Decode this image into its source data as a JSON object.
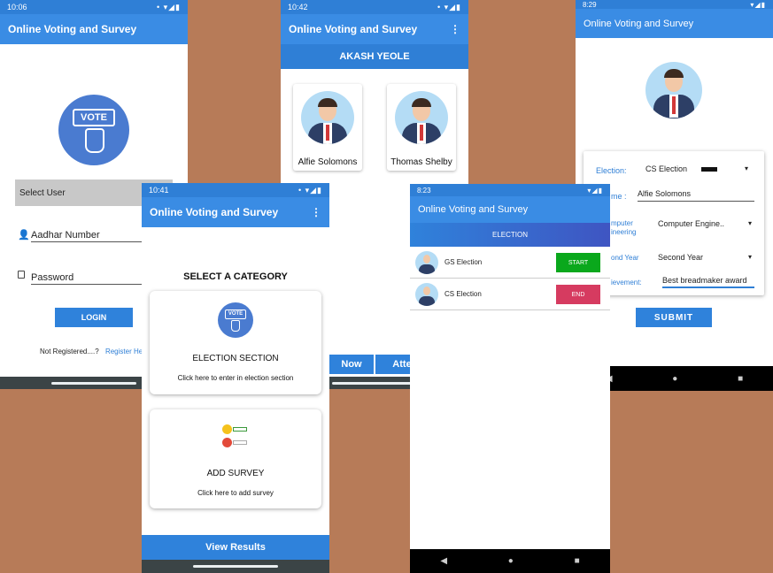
{
  "app_title": "Online Voting and Survey",
  "login": {
    "time": "10:06",
    "select_user": "Select User",
    "aadhar_placeholder": "Aadhar Number",
    "password_placeholder": "Password",
    "login_button": "LOGIN",
    "not_registered": "Not Registered....?",
    "register_link": "Register He",
    "vote_label": "VOTE"
  },
  "candidates": {
    "time": "10:42",
    "user_name": "AKASH YEOLE",
    "items": [
      {
        "name": "Alfie Solomons"
      },
      {
        "name": "Thomas Shelby"
      }
    ],
    "bottom_buttons": [
      "Now",
      "Atte"
    ]
  },
  "category": {
    "time": "10:41",
    "heading": "SELECT A CATEGORY",
    "election_title": "ELECTION SECTION",
    "election_sub": "Click here to enter in election section",
    "survey_title": "ADD SURVEY",
    "survey_sub": "Click here to add survey",
    "view_results": "View Results",
    "vote_label": "VOTE"
  },
  "election_list": {
    "time": "8:23",
    "header": "ELECTION",
    "rows": [
      {
        "name": "GS Election",
        "action": "START",
        "color": "#0aa81c"
      },
      {
        "name": "CS Election",
        "action": "END",
        "color": "#d63b60"
      }
    ]
  },
  "nominate": {
    "time": "8:29",
    "election_label": "Election:",
    "election_value": "CS Election",
    "name_label": "me :",
    "name_value": "Alfie Solomons",
    "dept_label_1": "mputer",
    "dept_label_2": "ineering",
    "dept_value": "Computer Engine..",
    "year_label": "ond Year",
    "year_value": "Second Year",
    "achievement_label": "ievement:",
    "achievement_value": "Best breadmaker award",
    "submit": "SUBMIT"
  }
}
